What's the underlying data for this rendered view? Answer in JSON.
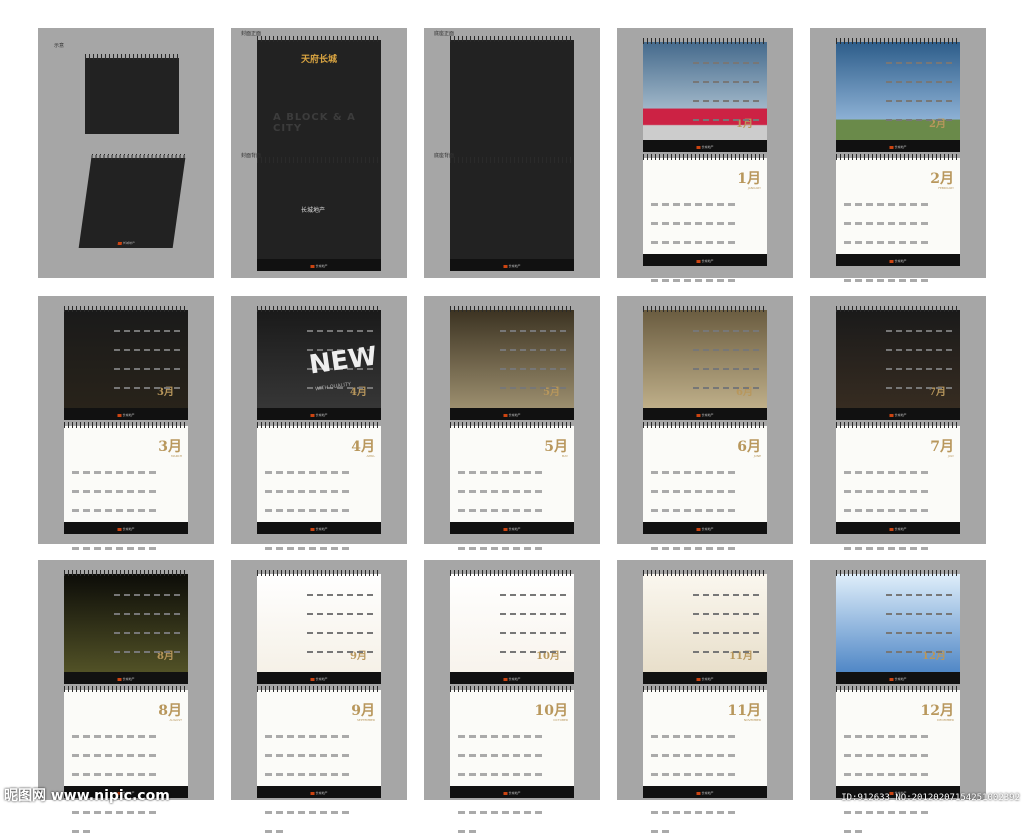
{
  "labels": {
    "preview": "示意",
    "cover_front": "封面正面",
    "cover_back": "封面背面",
    "base_front": "底座正面",
    "base_back": "底座背面"
  },
  "cover": {
    "title": "天府长城",
    "slogan": "A BLOCK & A CITY",
    "brand": "长城地产"
  },
  "months": [
    {
      "num": "1",
      "big": "1月",
      "en": "JANUARY"
    },
    {
      "num": "2",
      "big": "2月",
      "en": "FEBRUARY"
    },
    {
      "num": "3",
      "big": "3月",
      "en": "MARCH"
    },
    {
      "num": "4",
      "big": "4月",
      "en": "APRIL"
    },
    {
      "num": "5",
      "big": "5月",
      "en": "MAY"
    },
    {
      "num": "6",
      "big": "6月",
      "en": "JUNE"
    },
    {
      "num": "7",
      "big": "7月",
      "en": "JULY"
    },
    {
      "num": "8",
      "big": "8月",
      "en": "AUGUST"
    },
    {
      "num": "9",
      "big": "9月",
      "en": "SEPTEMBER"
    },
    {
      "num": "10",
      "big": "10月",
      "en": "OCTOBER"
    },
    {
      "num": "11",
      "big": "11月",
      "en": "NOVEMBER"
    },
    {
      "num": "12",
      "big": "12月",
      "en": "DECEMBER"
    }
  ],
  "art_text": {
    "new": "NEW",
    "new_sub": "WITH QUALITY"
  },
  "watermark": {
    "site": "昵图网 www.nipic.com",
    "id": "ID:912633 NO:20120207154251002392"
  },
  "colors": {
    "panel": "#a6a6a6",
    "dark": "#222222",
    "gold": "#b8975c"
  }
}
